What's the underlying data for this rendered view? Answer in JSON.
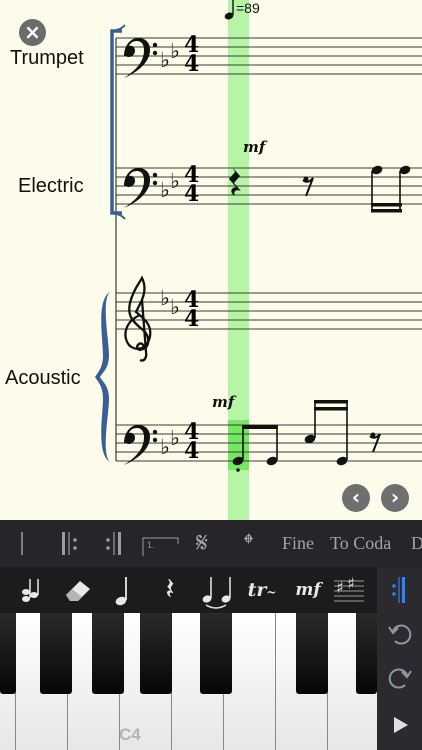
{
  "score": {
    "tempo": "=89",
    "instruments": [
      "Trumpet",
      "Electric",
      "Acoustic"
    ],
    "dynamic_marks": [
      "mf",
      "mf"
    ],
    "time_signature": {
      "top": "4",
      "bottom": "4"
    }
  },
  "bar_row": {
    "items": [
      "Fine",
      "To Coda",
      "D"
    ]
  },
  "tools": {
    "trill_label": "tr",
    "dynamic_label": "mf"
  },
  "keyboard": {
    "c4_label": "C4"
  },
  "colors": {
    "playhead": "#8df07e",
    "score_bg": "#fdfcea",
    "accent_blue": "#2f80ff",
    "brace_blue": "#3a5f96",
    "toolbar_bg": "#1c1c1f"
  },
  "icons": {
    "close": "close-icon",
    "prev": "chevron-left-icon",
    "next": "chevron-right-icon",
    "undo": "undo-icon",
    "redo": "redo-icon",
    "play": "play-icon",
    "eraser": "eraser-icon"
  }
}
